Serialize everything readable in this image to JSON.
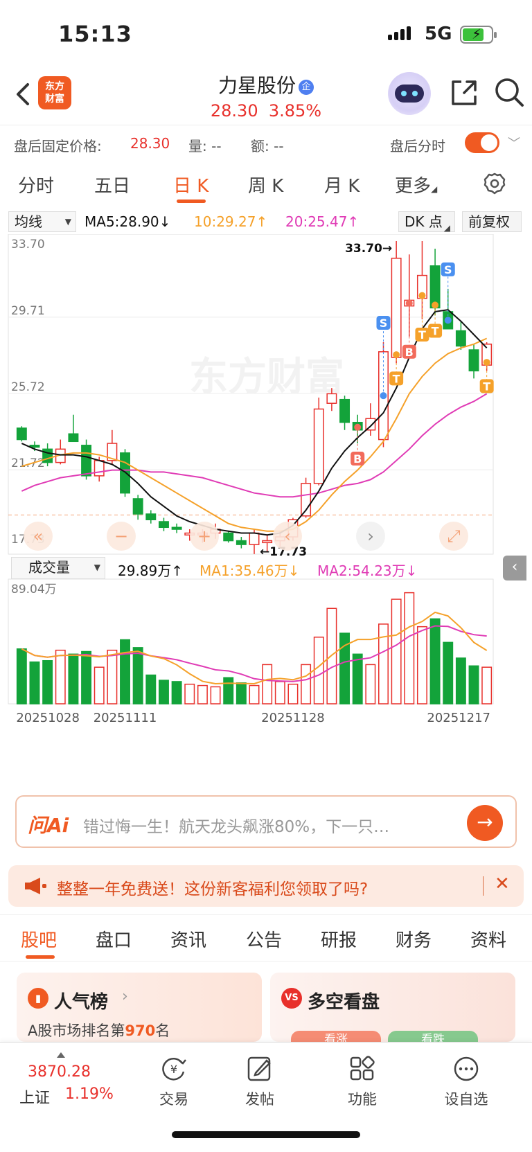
{
  "status_bar": {
    "time": "15:13",
    "network": "5G"
  },
  "header": {
    "logo_line1": "东方",
    "logo_line2": "财富",
    "stock_name": "力星股份",
    "badge": "企",
    "price": "28.30",
    "change_pct": "3.85%"
  },
  "after_hours": {
    "fixed_price_label": "盘后固定价格:",
    "fixed_price_value": "28.30",
    "volume_label": "量:",
    "volume_value": "--",
    "amount_label": "额:",
    "amount_value": "--",
    "session_label": "盘后分时"
  },
  "period_tabs": [
    "分时",
    "五日",
    "日 K",
    "周 K",
    "月 K",
    "更多"
  ],
  "ma_bar": {
    "selector": "均线",
    "ma5": "MA5:28.90",
    "ma10": "10:29.27",
    "ma20": "20:25.47",
    "dk_button": "DK 点",
    "adjust_button": "前复权"
  },
  "colors": {
    "up": "#e8302b",
    "down": "#13a33a",
    "ma5": "#111111",
    "ma10": "#f5a12a",
    "ma20": "#e03bb5",
    "accent": "#f05a22"
  },
  "chart_data": {
    "type": "candlestick",
    "dates_shown": [
      "20251028",
      "20251111",
      "20251128",
      "20251217"
    ],
    "price_axis_labels": [
      "33.70",
      "29.71",
      "25.72",
      "21.72",
      "17.73"
    ],
    "ylim": [
      17.73,
      33.7
    ],
    "high_label": "33.70",
    "low_label": "17.73",
    "watermark": "东方财富",
    "candles": [
      {
        "o": 23.9,
        "h": 24.0,
        "l": 23.2,
        "c": 23.3
      },
      {
        "o": 23.0,
        "h": 23.2,
        "l": 22.7,
        "c": 22.9
      },
      {
        "o": 22.8,
        "h": 23.1,
        "l": 21.9,
        "c": 22.1
      },
      {
        "o": 22.1,
        "h": 23.3,
        "l": 22.0,
        "c": 22.8
      },
      {
        "o": 23.6,
        "h": 24.6,
        "l": 23.3,
        "c": 23.2
      },
      {
        "o": 23.0,
        "h": 23.3,
        "l": 21.2,
        "c": 21.4
      },
      {
        "o": 21.4,
        "h": 22.4,
        "l": 21.1,
        "c": 22.2
      },
      {
        "o": 22.2,
        "h": 23.8,
        "l": 22.0,
        "c": 23.1
      },
      {
        "o": 22.6,
        "h": 22.8,
        "l": 20.3,
        "c": 20.5
      },
      {
        "o": 20.2,
        "h": 20.4,
        "l": 19.1,
        "c": 19.4
      },
      {
        "o": 19.4,
        "h": 19.6,
        "l": 18.9,
        "c": 19.1
      },
      {
        "o": 19.0,
        "h": 19.2,
        "l": 18.5,
        "c": 18.7
      },
      {
        "o": 18.7,
        "h": 18.9,
        "l": 18.4,
        "c": 18.6
      },
      {
        "o": 18.3,
        "h": 18.6,
        "l": 18.0,
        "c": 18.4
      },
      {
        "o": 18.3,
        "h": 18.6,
        "l": 17.9,
        "c": 18.4
      },
      {
        "o": 18.4,
        "h": 18.9,
        "l": 18.1,
        "c": 18.6
      },
      {
        "o": 18.4,
        "h": 18.5,
        "l": 17.9,
        "c": 18.0
      },
      {
        "o": 18.0,
        "h": 18.2,
        "l": 17.6,
        "c": 17.8
      },
      {
        "o": 17.8,
        "h": 18.6,
        "l": 17.3,
        "c": 18.4
      },
      {
        "o": 17.9,
        "h": 18.3,
        "l": 17.4,
        "c": 18.0
      },
      {
        "o": 18.0,
        "h": 18.5,
        "l": 17.7,
        "c": 18.2
      },
      {
        "o": 18.2,
        "h": 19.2,
        "l": 18.0,
        "c": 19.1
      },
      {
        "o": 19.3,
        "h": 21.3,
        "l": 19.2,
        "c": 21.0
      },
      {
        "o": 21.0,
        "h": 25.5,
        "l": 20.9,
        "c": 24.9
      },
      {
        "o": 25.2,
        "h": 26.0,
        "l": 24.8,
        "c": 25.7
      },
      {
        "o": 25.4,
        "h": 25.6,
        "l": 23.8,
        "c": 24.2
      },
      {
        "o": 24.2,
        "h": 24.6,
        "l": 23.1,
        "c": 23.8
      },
      {
        "o": 23.8,
        "h": 25.2,
        "l": 23.5,
        "c": 24.4
      },
      {
        "o": 23.3,
        "h": 28.4,
        "l": 22.9,
        "c": 27.9
      },
      {
        "o": 27.6,
        "h": 33.7,
        "l": 27.3,
        "c": 32.8
      },
      {
        "o": 30.3,
        "h": 33.0,
        "l": 28.7,
        "c": 30.6
      },
      {
        "o": 30.7,
        "h": 33.7,
        "l": 29.6,
        "c": 31.9
      },
      {
        "o": 32.4,
        "h": 33.3,
        "l": 29.8,
        "c": 30.2
      },
      {
        "o": 30.0,
        "h": 31.2,
        "l": 29.1,
        "c": 29.1
      },
      {
        "o": 29.0,
        "h": 29.5,
        "l": 28.0,
        "c": 28.2
      },
      {
        "o": 28.0,
        "h": 28.3,
        "l": 26.5,
        "c": 26.9
      },
      {
        "o": 27.2,
        "h": 28.4,
        "l": 26.9,
        "c": 28.3
      }
    ],
    "ma5": [
      23.1,
      22.8,
      22.6,
      22.5,
      22.5,
      22.4,
      22.2,
      22.0,
      21.6,
      21.0,
      20.3,
      19.8,
      19.3,
      19.0,
      18.8,
      18.6,
      18.5,
      18.4,
      18.4,
      18.3,
      18.4,
      18.8,
      19.6,
      20.6,
      21.8,
      22.7,
      23.4,
      24.0,
      24.7,
      26.0,
      27.6,
      29.1,
      30.0,
      30.1,
      29.5,
      28.8,
      28.1
    ],
    "ma10": [
      21.9,
      22.1,
      22.3,
      22.5,
      22.6,
      22.6,
      22.5,
      22.3,
      22.1,
      21.7,
      21.3,
      20.9,
      20.5,
      20.1,
      19.7,
      19.3,
      18.9,
      18.7,
      18.6,
      18.5,
      18.5,
      18.6,
      19.0,
      19.6,
      20.4,
      21.1,
      21.7,
      22.4,
      23.2,
      24.4,
      25.7,
      26.6,
      27.3,
      27.8,
      28.1,
      28.3,
      28.6
    ],
    "ma20": [
      20.6,
      20.9,
      21.1,
      21.3,
      21.4,
      21.5,
      21.6,
      21.7,
      21.7,
      21.7,
      21.6,
      21.6,
      21.5,
      21.4,
      21.3,
      21.1,
      20.9,
      20.7,
      20.5,
      20.4,
      20.3,
      20.3,
      20.4,
      20.5,
      20.7,
      20.9,
      21.0,
      21.2,
      21.6,
      22.2,
      22.8,
      23.5,
      24.1,
      24.6,
      25.0,
      25.3,
      25.7
    ],
    "signals": [
      {
        "label": "S",
        "index": 28,
        "type": "sell"
      },
      {
        "label": "S",
        "index": 33,
        "type": "sell"
      },
      {
        "label": "B",
        "index": 26,
        "type": "buy"
      },
      {
        "label": "B",
        "index": 30,
        "type": "buy"
      },
      {
        "label": "T",
        "index": 29,
        "type": "t"
      },
      {
        "label": "T",
        "index": 31,
        "type": "t"
      },
      {
        "label": "T",
        "index": 32,
        "type": "t"
      },
      {
        "label": "T",
        "index": 36,
        "type": "t"
      }
    ],
    "volume_panel": {
      "selector": "成交量",
      "current": "29.89万",
      "ma1": "MA1:35.46万",
      "ma2": "MA2:54.23万",
      "axis_max": "89.04万",
      "ymax": 89.04,
      "values": [
        42,
        32,
        33,
        41,
        38,
        40,
        28,
        41,
        49,
        43,
        22,
        18,
        17,
        15,
        14,
        13,
        20,
        16,
        14,
        30,
        17,
        15,
        30,
        51,
        73,
        54,
        38,
        30,
        61,
        80,
        85,
        59,
        65,
        47,
        35,
        29,
        28
      ]
    }
  },
  "ask_bar": {
    "brand": "问Ai",
    "placeholder": "错过悔一生！航天龙头飙涨80%，下一只…",
    "go": "→"
  },
  "promo": {
    "text": "整整一年免费送！这份新客福利您领取了吗?",
    "close": "✕"
  },
  "content_tabs": [
    "股吧",
    "盘口",
    "资讯",
    "公告",
    "研报",
    "财务",
    "资料"
  ],
  "cards": {
    "popularity": {
      "title": "人气榜",
      "rank_prefix": "A股市场排名第",
      "rank": "970",
      "rank_suffix": "名"
    },
    "sentiment": {
      "title": "多空看盘",
      "up_label": "看涨",
      "down_label": "看跌"
    }
  },
  "bottom_nav": {
    "index_value": "3870.28",
    "index_name": "上证",
    "index_pct": "1.19%",
    "items": [
      "交易",
      "发帖",
      "功能",
      "设自选"
    ]
  }
}
